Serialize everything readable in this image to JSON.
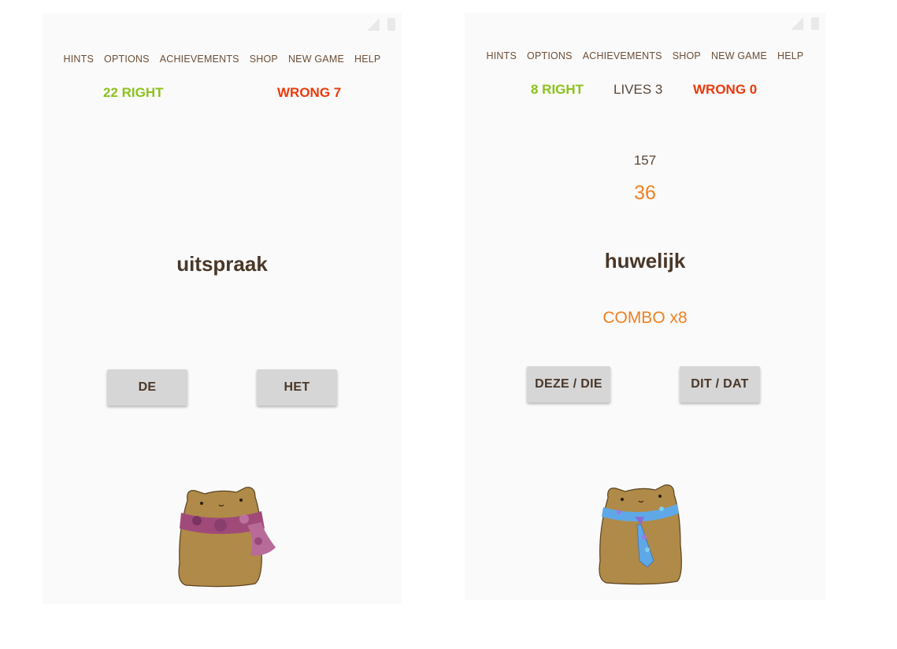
{
  "left_screen": {
    "menu": [
      "HINTS",
      "OPTIONS",
      "ACHIEVEMENTS",
      "SHOP",
      "NEW GAME",
      "HELP"
    ],
    "right_score": "22 RIGHT",
    "wrong_score": "WRONG 7",
    "word": "uitspraak",
    "buttons": {
      "option1": "DE",
      "option2": "HET"
    },
    "mascot": {
      "accessory": "scarf-icon",
      "scarf_color": "#a04a7a"
    }
  },
  "right_screen": {
    "menu": [
      "HINTS",
      "OPTIONS",
      "ACHIEVEMENTS",
      "SHOP",
      "NEW GAME",
      "HELP"
    ],
    "right_score": "8 RIGHT",
    "lives": "LIVES 3",
    "wrong_score": "WRONG 0",
    "points": "157",
    "timer": "36",
    "word": "huwelijk",
    "combo": "COMBO x8",
    "buttons": {
      "option1": "DEZE / DIE",
      "option2": "DIT / DAT"
    },
    "mascot": {
      "accessory": "tie-icon",
      "tie_color": "#5fa8e8"
    }
  },
  "colors": {
    "right": "#8cc21c",
    "wrong": "#ea3a0c",
    "accent": "#f08020",
    "text": "#4a3728"
  }
}
